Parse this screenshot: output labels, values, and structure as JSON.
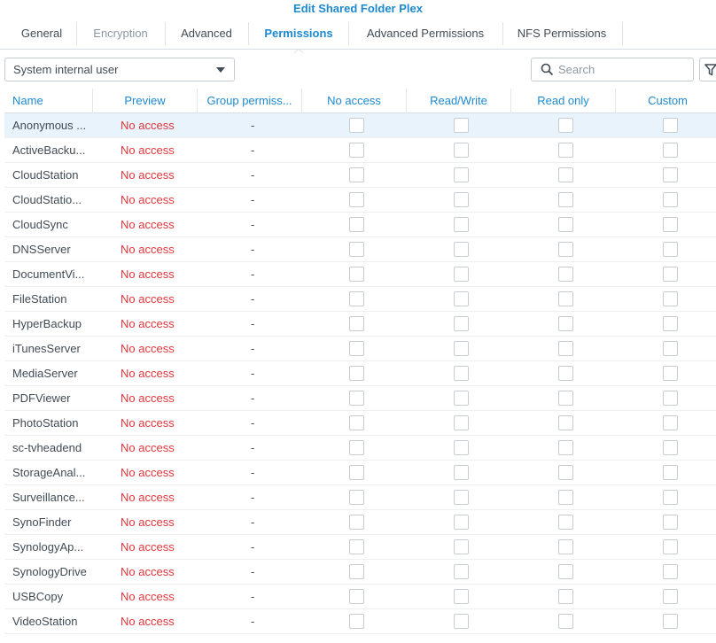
{
  "window": {
    "title": "Edit Shared Folder Plex"
  },
  "tabs": [
    {
      "label": "General",
      "state": "normal"
    },
    {
      "label": "Encryption",
      "state": "disabled"
    },
    {
      "label": "Advanced",
      "state": "normal"
    },
    {
      "label": "Permissions",
      "state": "active"
    },
    {
      "label": "Advanced Permissions",
      "state": "normal"
    },
    {
      "label": "NFS Permissions",
      "state": "normal"
    }
  ],
  "toolbar": {
    "user_type_value": "System internal user",
    "search_placeholder": "Search",
    "filter_icon": "filter-icon",
    "search_icon": "search-icon"
  },
  "table": {
    "columns": {
      "name": "Name",
      "preview": "Preview",
      "group": "Group permiss...",
      "no_access": "No access",
      "read_write": "Read/Write",
      "read_only": "Read only",
      "custom": "Custom"
    },
    "rows": [
      {
        "name": "Anonymous ...",
        "preview": "No access",
        "group": "-",
        "selected": true
      },
      {
        "name": "ActiveBacku...",
        "preview": "No access",
        "group": "-"
      },
      {
        "name": "CloudStation",
        "preview": "No access",
        "group": "-"
      },
      {
        "name": "CloudStatio...",
        "preview": "No access",
        "group": "-"
      },
      {
        "name": "CloudSync",
        "preview": "No access",
        "group": "-"
      },
      {
        "name": "DNSServer",
        "preview": "No access",
        "group": "-"
      },
      {
        "name": "DocumentVi...",
        "preview": "No access",
        "group": "-"
      },
      {
        "name": "FileStation",
        "preview": "No access",
        "group": "-"
      },
      {
        "name": "HyperBackup",
        "preview": "No access",
        "group": "-"
      },
      {
        "name": "iTunesServer",
        "preview": "No access",
        "group": "-"
      },
      {
        "name": "MediaServer",
        "preview": "No access",
        "group": "-"
      },
      {
        "name": "PDFViewer",
        "preview": "No access",
        "group": "-"
      },
      {
        "name": "PhotoStation",
        "preview": "No access",
        "group": "-"
      },
      {
        "name": "sc-tvheadend",
        "preview": "No access",
        "group": "-"
      },
      {
        "name": "StorageAnal...",
        "preview": "No access",
        "group": "-"
      },
      {
        "name": "Surveillance...",
        "preview": "No access",
        "group": "-"
      },
      {
        "name": "SynoFinder",
        "preview": "No access",
        "group": "-"
      },
      {
        "name": "SynologyAp...",
        "preview": "No access",
        "group": "-"
      },
      {
        "name": "SynologyDrive",
        "preview": "No access",
        "group": "-"
      },
      {
        "name": "USBCopy",
        "preview": "No access",
        "group": "-"
      },
      {
        "name": "VideoStation",
        "preview": "No access",
        "group": "-"
      }
    ]
  },
  "colors": {
    "accent": "#1d89d0",
    "no_access_text": "#e0353b",
    "selected_row": "#e8f3fc"
  }
}
